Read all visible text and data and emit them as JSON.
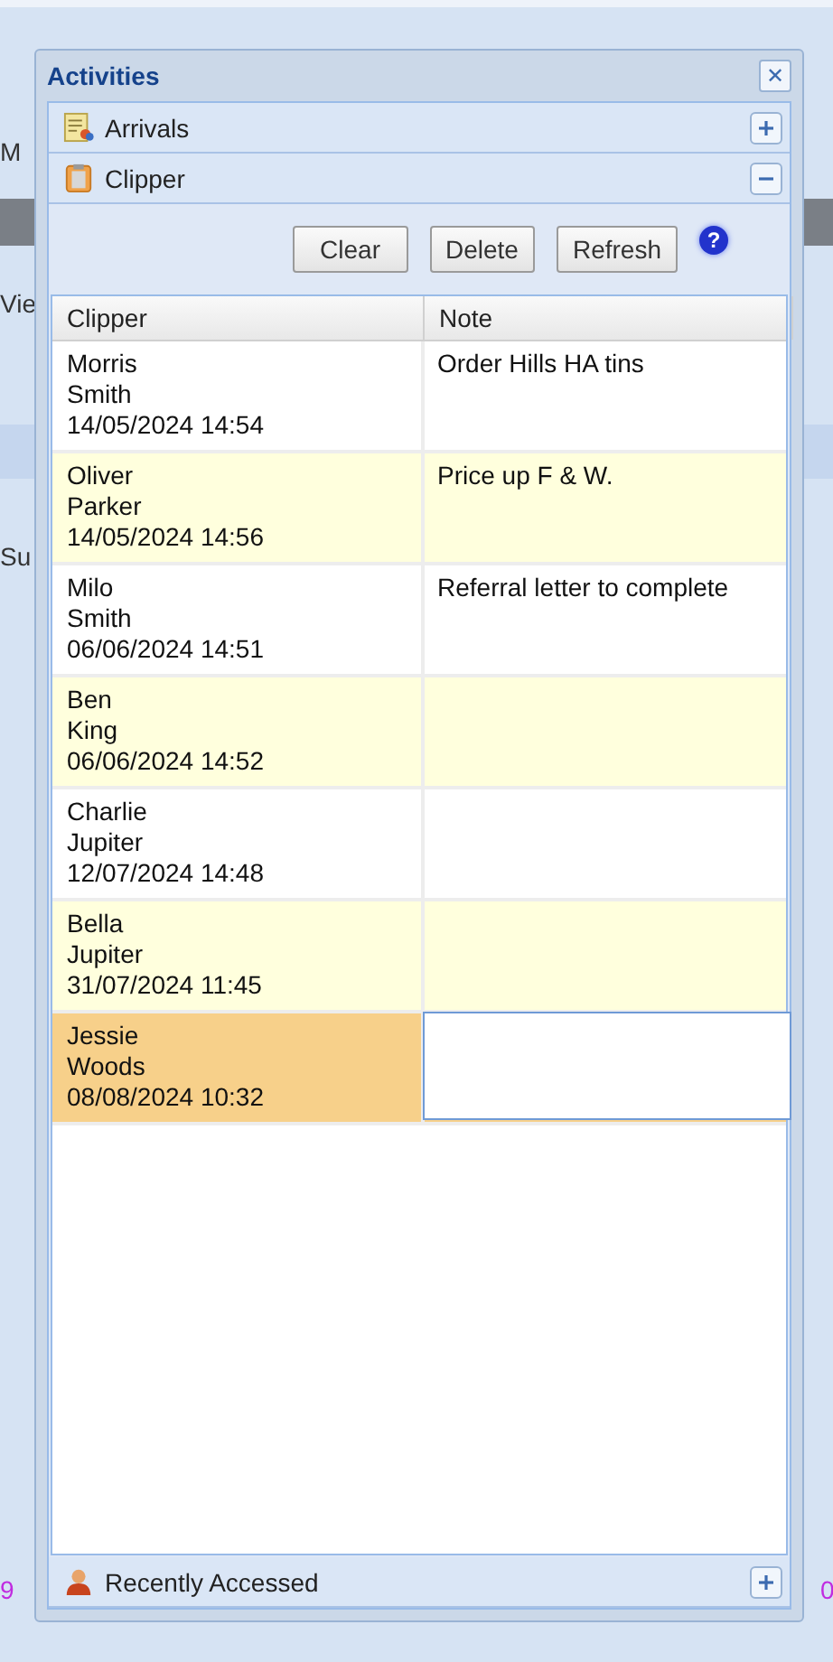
{
  "background": {
    "left_fragments": [
      {
        "text": "M",
        "kind": "plain"
      },
      {
        "text": "Vie",
        "kind": "plain"
      },
      {
        "text": "Su",
        "kind": "plain"
      },
      {
        "text": "9",
        "kind": "accent"
      }
    ],
    "right_fragments": [
      {
        "text": "0",
        "kind": "accent"
      }
    ]
  },
  "window": {
    "title": "Activities",
    "close": "✕"
  },
  "sections": [
    {
      "title": "Arrivals",
      "kind": "report",
      "expanded": false
    },
    {
      "title": "Clipper",
      "kind": "clipboard",
      "expanded": true
    },
    {
      "title": "Recently Accessed",
      "kind": "person",
      "expanded": false
    }
  ],
  "toolbar": {
    "buttons": [
      "Clear",
      "Delete",
      "Refresh"
    ],
    "help": "?"
  },
  "table": {
    "columns": [
      "Clipper",
      "Note"
    ],
    "rows": [
      {
        "first": "Morris",
        "last": "Smith",
        "time": "14/05/2024 14:54",
        "note": "Order Hills HA tins",
        "selected": false
      },
      {
        "first": "Oliver",
        "last": "Parker",
        "time": "14/05/2024 14:56",
        "note": "Price up F & W.",
        "selected": false
      },
      {
        "first": "Milo",
        "last": "Smith",
        "time": "06/06/2024 14:51",
        "note": "Referral letter to complete",
        "selected": false
      },
      {
        "first": "Ben",
        "last": "King",
        "time": "06/06/2024 14:52",
        "note": "",
        "selected": false
      },
      {
        "first": "Charlie",
        "last": "Jupiter",
        "time": "12/07/2024 14:48",
        "note": "",
        "selected": false
      },
      {
        "first": "Bella",
        "last": "Jupiter",
        "time": "31/07/2024 11:45",
        "note": "",
        "selected": false
      },
      {
        "first": "Jessie",
        "last": "Woods",
        "time": "08/08/2024 10:32",
        "note": "",
        "selected": true
      }
    ]
  }
}
